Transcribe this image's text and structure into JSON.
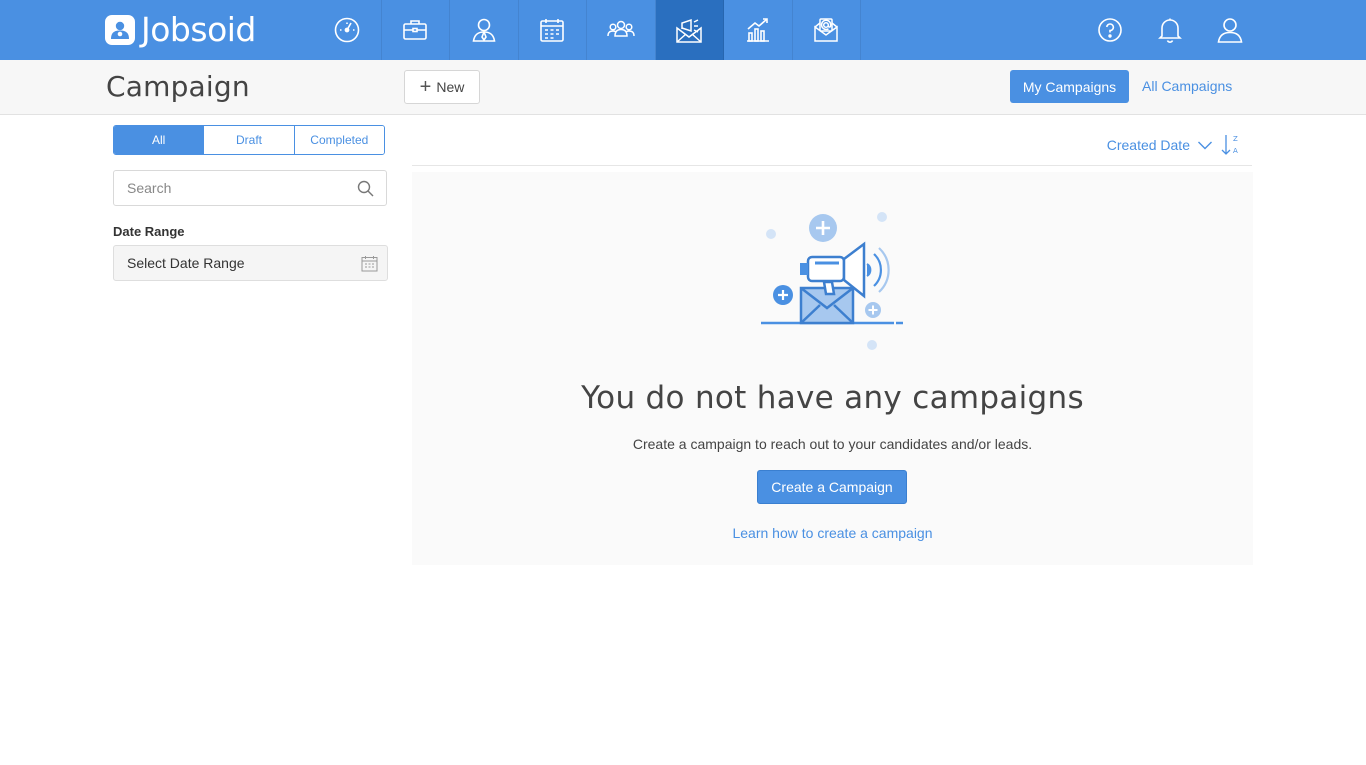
{
  "app": {
    "brand": "Jobsoid",
    "accent": "#4a90e2",
    "accent_dark": "#2a6fbf"
  },
  "nav": {
    "items": [
      {
        "icon": "dashboard-gauge-icon",
        "active": false
      },
      {
        "icon": "briefcase-icon",
        "active": false
      },
      {
        "icon": "candidate-user-icon",
        "active": false
      },
      {
        "icon": "calendar-icon",
        "active": false
      },
      {
        "icon": "people-group-icon",
        "active": false
      },
      {
        "icon": "campaign-megaphone-icon",
        "active": true
      },
      {
        "icon": "reports-chart-icon",
        "active": false
      },
      {
        "icon": "email-at-icon",
        "active": false
      }
    ],
    "utilities": [
      "help-icon",
      "bell-icon",
      "profile-icon"
    ]
  },
  "header": {
    "title": "Campaign",
    "new_label": "New",
    "my_campaigns_label": "My Campaigns",
    "all_campaigns_label": "All Campaigns"
  },
  "filters": {
    "tabs": [
      "All",
      "Draft",
      "Completed"
    ],
    "active_tab": "All",
    "search_placeholder": "Search",
    "date_range_label": "Date Range",
    "date_range_value": "Select Date Range"
  },
  "sort": {
    "label": "Created Date"
  },
  "empty_state": {
    "title": "You do not have any campaigns",
    "subtitle": "Create a campaign to reach out to your candidates and/or leads.",
    "button_label": "Create a Campaign",
    "link_label": "Learn how to create a campaign"
  }
}
